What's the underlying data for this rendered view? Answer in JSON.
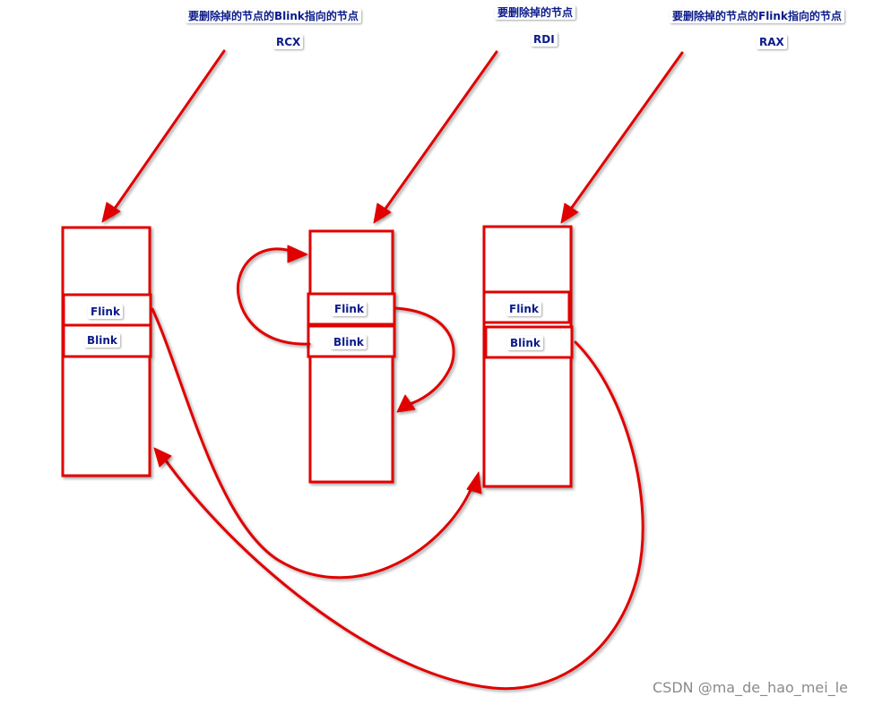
{
  "pointers": [
    {
      "description": "要删除掉的节点的Blink指向的节点",
      "register": "RCX"
    },
    {
      "description": "要删除掉的节点",
      "register": "RDI"
    },
    {
      "description": "要删除掉的节点的Flink指向的节点",
      "register": "RAX"
    }
  ],
  "nodes": [
    {
      "flink": "Flink",
      "blink": "Blink"
    },
    {
      "flink": "Flink",
      "blink": "Blink"
    },
    {
      "flink": "Flink",
      "blink": "Blink"
    }
  ],
  "colors": {
    "arrow": "#e00000",
    "box": "#e00000",
    "label_text": "#0b1b8a",
    "watermark": "#8a8a8a"
  },
  "watermark": "CSDN @ma_de_hao_mei_le"
}
